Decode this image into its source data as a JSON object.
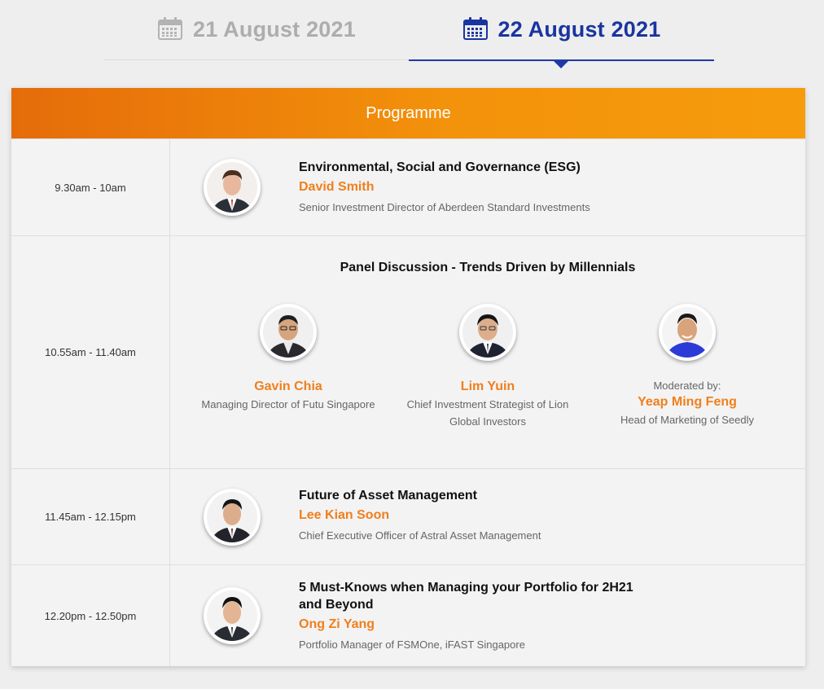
{
  "tabs": [
    {
      "label": "21 August 2021",
      "active": false,
      "icon": "calendar-icon"
    },
    {
      "label": "22 August 2021",
      "active": true,
      "icon": "calendar-icon"
    }
  ],
  "colors": {
    "accent_blue": "#1a35a0",
    "inactive_grey": "#adadad",
    "orange": "#f07f1c",
    "header_start": "#e56c0a",
    "header_end": "#f69c0c"
  },
  "programme": {
    "header": "Programme",
    "sessions": [
      {
        "time": "9.30am - 10am",
        "title": "Environmental, Social and Governance (ESG)",
        "speaker": "David Smith",
        "role": "Senior Investment Director of Aberdeen Standard Investments"
      },
      {
        "time": "10.55am - 11.40am",
        "title": "Panel Discussion - Trends Driven by Millennials",
        "panelists": [
          {
            "name": "Gavin Chia",
            "role_line1": "Managing Director of Futu Singapore",
            "role_line2": ""
          },
          {
            "name": "Lim Yuin",
            "role_line1": "Chief Investment Strategist of Lion",
            "role_line2": "Global Investors"
          },
          {
            "prefix": "Moderated by:",
            "name": "Yeap Ming Feng",
            "role_line1": "Head of Marketing of Seedly"
          }
        ]
      },
      {
        "time": "11.45am - 12.15pm",
        "title": "Future of Asset Management",
        "speaker": "Lee Kian Soon",
        "role": "Chief Executive Officer of Astral Asset Management"
      },
      {
        "time": "12.20pm - 12.50pm",
        "title_line1": "5 Must-Knows when Managing your Portfolio for 2H21",
        "title_line2": "and Beyond",
        "speaker": "Ong Zi Yang",
        "role": "Portfolio Manager of FSMOne, iFAST Singapore"
      }
    ]
  }
}
